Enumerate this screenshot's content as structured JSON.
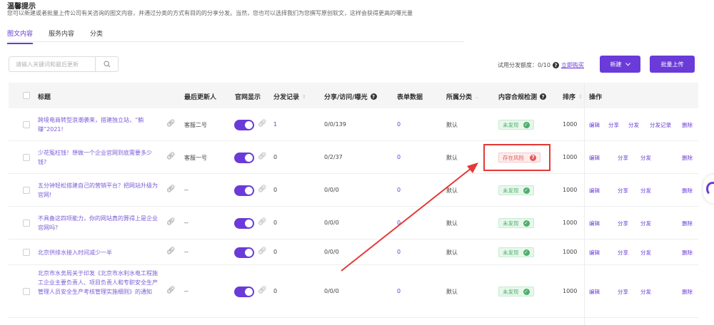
{
  "notice": {
    "title": "温馨提示",
    "text": "您可以新建或者批量上传公司有关咨询的图文内容，并通过分类的方式有目的的分享分发。当然，您也可以选择我们为您撰写原创软文，这样会获得更高的曝光量"
  },
  "tabs": [
    {
      "label": "图文内容",
      "active": true
    },
    {
      "label": "服务内容",
      "active": false
    },
    {
      "label": "分类",
      "active": false
    }
  ],
  "search": {
    "placeholder": "请输入关键词和最后更新"
  },
  "quota": {
    "label": "试用分发额度：0/10",
    "buy": "立即购买"
  },
  "buttons": {
    "new": "新建",
    "batch_upload": "批量上传"
  },
  "columns": {
    "title": "标题",
    "updater": "最后更新人",
    "site_display": "官网显示",
    "dist_records": "分发记录",
    "share_stats": "分享/访问/曝光",
    "form_data": "表单数据",
    "category": "所属分类",
    "compliance": "内容合规检测",
    "sort": "排序",
    "actions": "操作"
  },
  "rows": [
    {
      "title": "跨境电商转型浪潮袭来，搭建独立站，“躺赚”2021!",
      "updater": "客服二号",
      "site_display": true,
      "dist_records": "1",
      "share_stats": "0/0/139",
      "form_data": "0",
      "category": "默认",
      "compliance": "未发现",
      "compliance_status": "ok",
      "sort": "1000",
      "actions": [
        "编辑",
        "分享",
        "分发",
        "分发记录",
        "删除"
      ]
    },
    {
      "title": "少花冤枉钱！想做一个企业官网到底需要多少钱?",
      "updater": "客服一号",
      "site_display": true,
      "dist_records": "0",
      "share_stats": "0/2/37",
      "form_data": "0",
      "category": "默认",
      "compliance": "存在风险",
      "compliance_status": "risk",
      "sort": "1000",
      "actions": [
        "编辑",
        "分享",
        "分发",
        "删除"
      ]
    },
    {
      "title": "五分钟轻松搭建自己的营销平台？把网站升级为官网!",
      "updater": "--",
      "site_display": true,
      "dist_records": "0",
      "share_stats": "0/0/0",
      "form_data": "0",
      "category": "默认",
      "compliance": "未发现",
      "compliance_status": "ok",
      "sort": "1000",
      "actions": [
        "编辑",
        "分享",
        "分发",
        "删除"
      ]
    },
    {
      "title": "不具备这四项能力，你的网站真的算得上是企业官网吗?",
      "updater": "--",
      "site_display": true,
      "dist_records": "0",
      "share_stats": "0/0/0",
      "form_data": "0",
      "category": "默认",
      "compliance": "未发现",
      "compliance_status": "ok",
      "sort": "1000",
      "actions": [
        "编辑",
        "分享",
        "分发",
        "删除"
      ]
    },
    {
      "title": "北京供排水接入时间减少一半",
      "updater": "--",
      "site_display": true,
      "dist_records": "0",
      "share_stats": "0/0/0",
      "form_data": "0",
      "category": "默认",
      "compliance": "未发现",
      "compliance_status": "ok",
      "sort": "1000",
      "actions": [
        "编辑",
        "分享",
        "分发",
        "删除"
      ]
    },
    {
      "title": "北京市水务局关于印发《北京市水利水电工程施工企业主要负责人、项目负责人和专职安全生产管理人员安全生产考核管理实施细则》的通知",
      "updater": "--",
      "site_display": true,
      "dist_records": "0",
      "share_stats": "0/0/0",
      "form_data": "0",
      "category": "默认",
      "compliance": "未发现",
      "compliance_status": "ok",
      "sort": "1000",
      "actions": [
        "编辑",
        "分享",
        "分发",
        "删除"
      ]
    }
  ]
}
